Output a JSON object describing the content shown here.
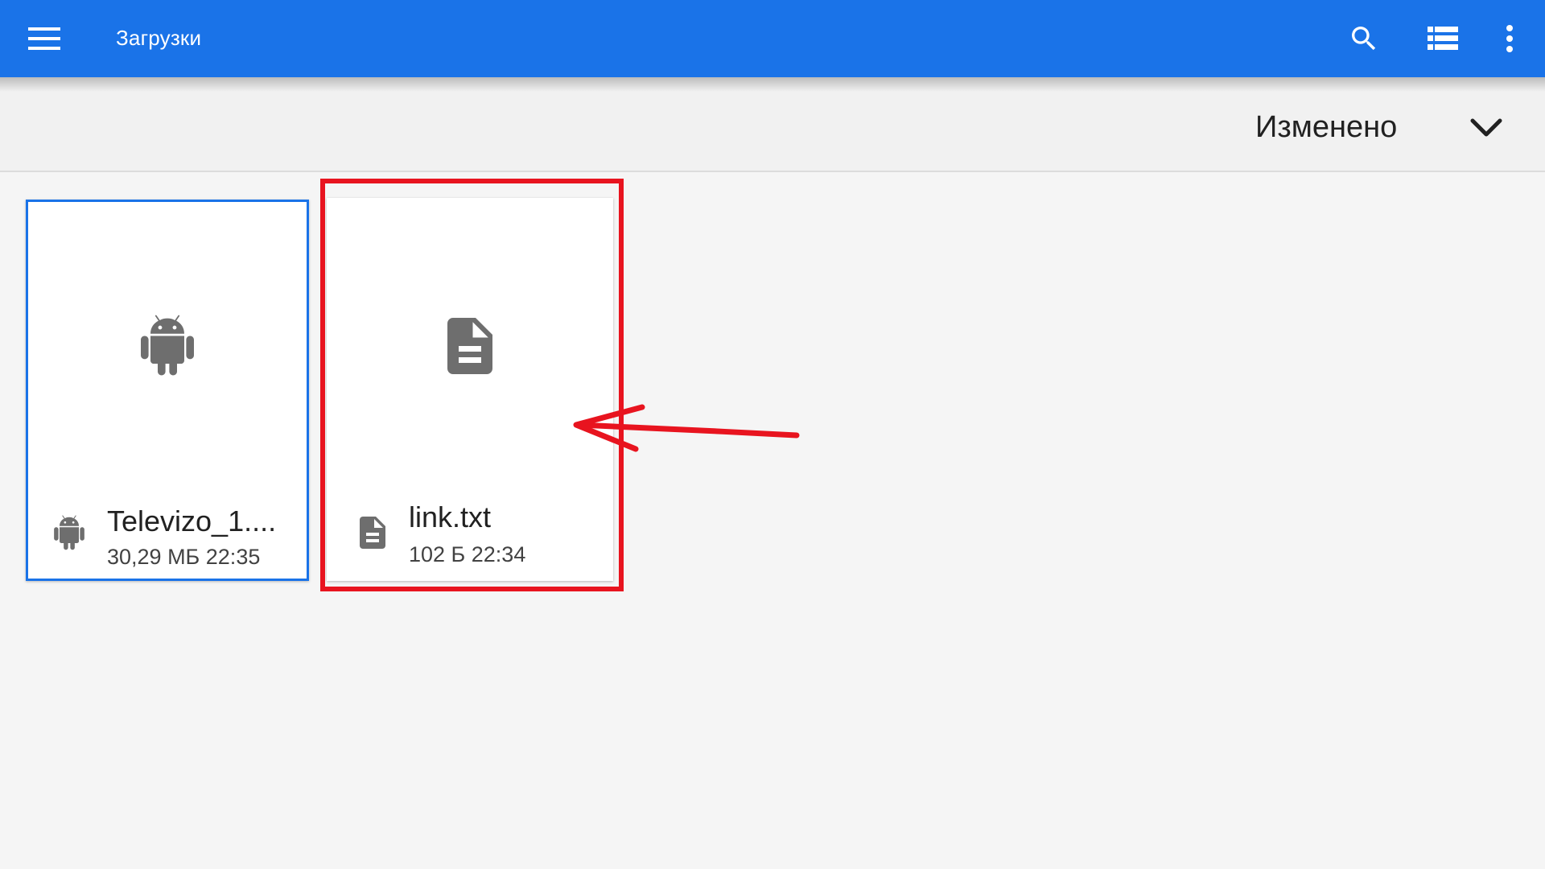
{
  "appbar": {
    "title": "Загрузки",
    "background": "#1a73e8",
    "icons": {
      "menu": "hamburger-menu-icon",
      "search": "search-icon",
      "list": "list-view-icon",
      "more": "more-vert-icon"
    }
  },
  "sortbar": {
    "label": "Изменено",
    "icon": "chevron-down-icon"
  },
  "files": [
    {
      "name": "Televizo_1....",
      "details": "30,29 МБ 22:35",
      "type_icon": "android-icon",
      "selected": true
    },
    {
      "name": "link.txt",
      "details": "102 Б 22:34",
      "type_icon": "document-icon",
      "selected": false
    }
  ],
  "annotation": {
    "color": "#e8141f"
  }
}
